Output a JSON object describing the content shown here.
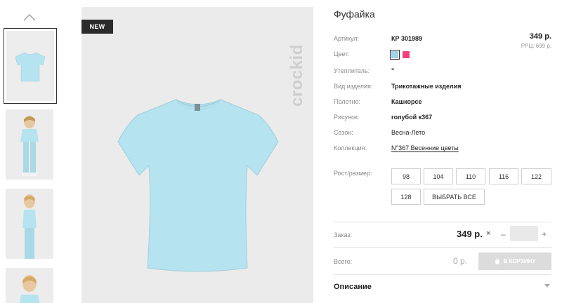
{
  "badge": "NEW",
  "brand": "crockid",
  "product": {
    "title": "Фуфайка",
    "price": "349 р.",
    "rrc": "РРЦ: 699 р."
  },
  "attributes": [
    {
      "label": "Артикул:",
      "value": "КР 301989",
      "style": "bold"
    },
    {
      "label": "Цвет:",
      "value": "",
      "style": "swatches"
    },
    {
      "label": "Утеплитель:",
      "value": "\"",
      "style": "normal"
    },
    {
      "label": "Вид изделия:",
      "value": "Трикотажные изделия",
      "style": "bold"
    },
    {
      "label": "Полотно:",
      "value": "Кашкорсе",
      "style": "bold"
    },
    {
      "label": "Рисунок:",
      "value": "голубой к367",
      "style": "bold"
    },
    {
      "label": "Сезон:",
      "value": "Весна-Лето",
      "style": "normal"
    },
    {
      "label": "Коллекция:",
      "value": "N°367 Весенние цветы",
      "style": "link"
    }
  ],
  "colors": {
    "swatch_blue": "#9fd3ea",
    "swatch_pink": "#f0417e"
  },
  "sizes": {
    "label": "Рост/размер:",
    "options": [
      "98",
      "104",
      "110",
      "116",
      "122",
      "128"
    ],
    "select_all": "ВЫБРАТЬ ВСЕ"
  },
  "order": {
    "label": "Заказ:",
    "price": "349 р.",
    "times": "×",
    "minus": "–",
    "plus": "+"
  },
  "total": {
    "label": "Всего:",
    "value": "0 р.",
    "cart_button": "В КОРЗИНУ"
  },
  "description": {
    "title": "Описание"
  }
}
